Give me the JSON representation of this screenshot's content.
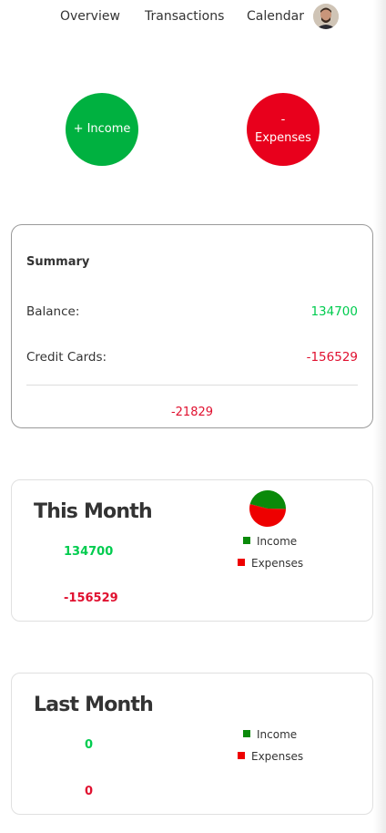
{
  "nav": {
    "items": [
      "Overview",
      "Transactions",
      "Calendar"
    ]
  },
  "actions": {
    "income_label": "+ Income",
    "expense_line1": "-",
    "expense_line2": "Expenses"
  },
  "summary": {
    "title": "Summary",
    "balance_label": "Balance:",
    "balance_value": "134700",
    "credit_label": "Credit Cards:",
    "credit_value": "-156529",
    "total": "-21829"
  },
  "this_month": {
    "title": "This Month",
    "income": "134700",
    "expenses": "-156529",
    "legend": [
      "Income",
      "Expenses"
    ],
    "pie": {
      "income": 134700,
      "expenses": 156529
    }
  },
  "last_month": {
    "title": "Last Month",
    "income": "0",
    "expenses": "0",
    "legend": [
      "Income",
      "Expenses"
    ]
  },
  "colors": {
    "income_green": "#00b140",
    "expense_red": "#e8001c",
    "income_text": "#00cc4f",
    "expense_text": "#e0102f",
    "legend_green": "#0a8a0a",
    "legend_red": "#ee0000"
  }
}
